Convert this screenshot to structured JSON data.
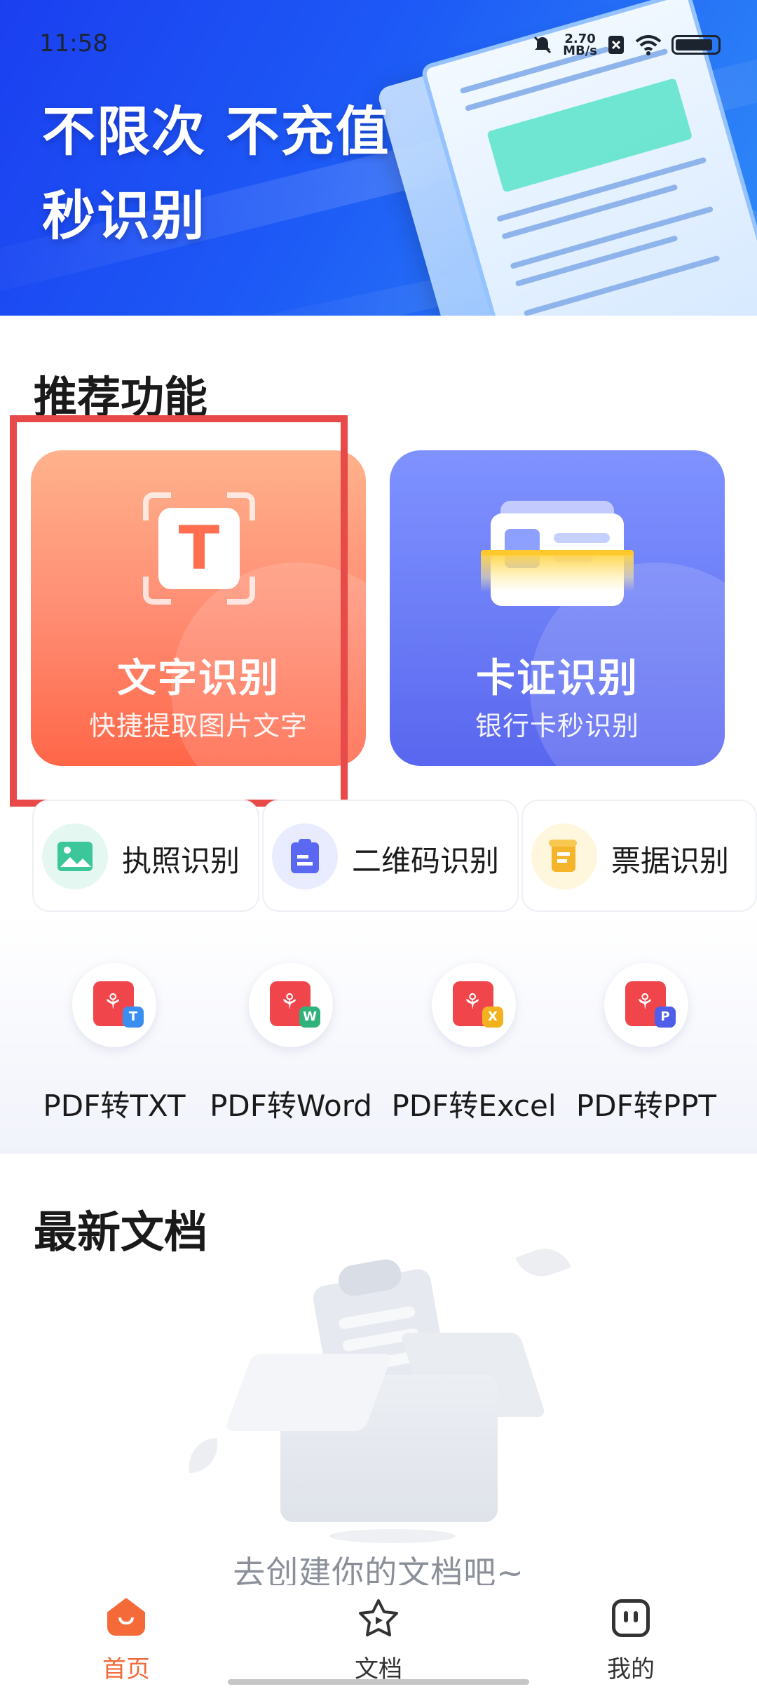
{
  "status_bar": {
    "time": "11:58",
    "net_speed": "2.70",
    "net_unit": "MB/s"
  },
  "banner": {
    "line1": "不限次 不充值",
    "line2": "秒识别"
  },
  "recommend": {
    "title": "推荐功能",
    "cards": [
      {
        "title": "文字识别",
        "subtitle": "快捷提取图片文字",
        "icon": "text-scan-icon"
      },
      {
        "title": "卡证识别",
        "subtitle": "银行卡秒识别",
        "icon": "id-card-scan-icon"
      }
    ],
    "pills": [
      {
        "label": "执照识别",
        "icon": "image-icon"
      },
      {
        "label": "二维码识别",
        "icon": "clipboard-icon"
      },
      {
        "label": "票据识别",
        "icon": "receipt-icon"
      }
    ],
    "pdf_tools": [
      {
        "label": "PDF转TXT",
        "badge": "T",
        "badge_color": "#3a8ef0"
      },
      {
        "label": "PDF转Word",
        "badge": "W",
        "badge_color": "#2fb37a"
      },
      {
        "label": "PDF转Excel",
        "badge": "X",
        "badge_color": "#f2b21f"
      },
      {
        "label": "PDF转PPT",
        "badge": "P",
        "badge_color": "#4f5ee8"
      }
    ]
  },
  "recent": {
    "title": "最新文档",
    "empty_text": "去创建你的文档吧~"
  },
  "nav": {
    "items": [
      {
        "label": "首页",
        "icon": "home-icon",
        "active": true
      },
      {
        "label": "文档",
        "icon": "document-star-icon",
        "active": false
      },
      {
        "label": "我的",
        "icon": "profile-icon",
        "active": false
      }
    ]
  },
  "colors": {
    "accent": "#f06a3a",
    "highlight": "#e84949",
    "banner": "#1d5af6"
  }
}
